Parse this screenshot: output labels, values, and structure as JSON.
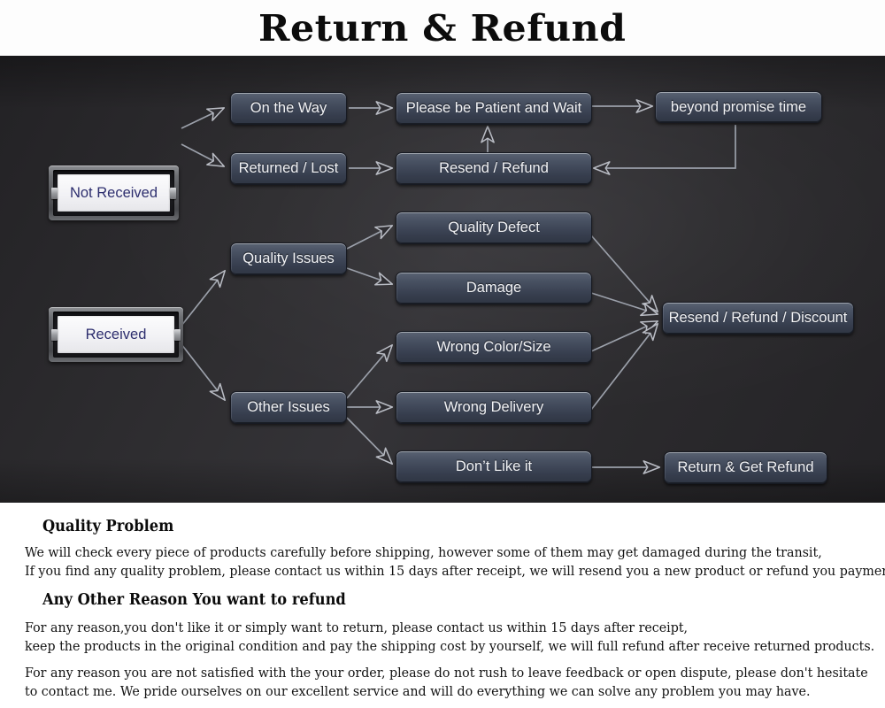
{
  "header": {
    "title": "Return & Refund"
  },
  "diagram": {
    "background_color": "#2c2b2e",
    "node_color": "#434b5c",
    "bezel_text_color": "#2d2e6e",
    "nodes": {
      "not_received": "Not Received",
      "received": "Received",
      "on_the_way": "On the Way",
      "returned_lost": "Returned / Lost",
      "please_wait": "Please be Patient and Wait",
      "resend_refund": "Resend / Refund",
      "beyond_promise_time": "beyond promise time",
      "quality_issues": "Quality Issues",
      "other_issues": "Other Issues",
      "quality_defect": "Quality Defect",
      "damage": "Damage",
      "wrong_color_size": "Wrong Color/Size",
      "wrong_delivery": "Wrong Delivery",
      "dont_like_it": "Don’t Like it",
      "resend_refund_discount": "Resend / Refund / Discount",
      "return_get_refund": "Return & Get Refund"
    }
  },
  "content": {
    "quality_problem": {
      "heading": "Quality Problem",
      "line1": "We will check every piece of products carefully before shipping, however some of them may get damaged during the transit,",
      "line2": "If you find any quality problem, please contact us within 15 days after receipt, we will resend you a new product or refund you payment."
    },
    "other_reason": {
      "heading": "Any Other Reason You want to refund",
      "line1": "For any reason,you don't like it or simply want to return, please contact us within 15 days after receipt,",
      "line2": "keep the products in the original condition and pay the shipping cost by yourself, we will full refund after receive returned products.",
      "line3": "For any reason you are not satisfied with the your order, please do not rush to leave feedback or open dispute, please don't hesitate",
      "line4": "to contact me. We pride ourselves on our excellent service and will do everything we can solve any problem you may have."
    }
  }
}
